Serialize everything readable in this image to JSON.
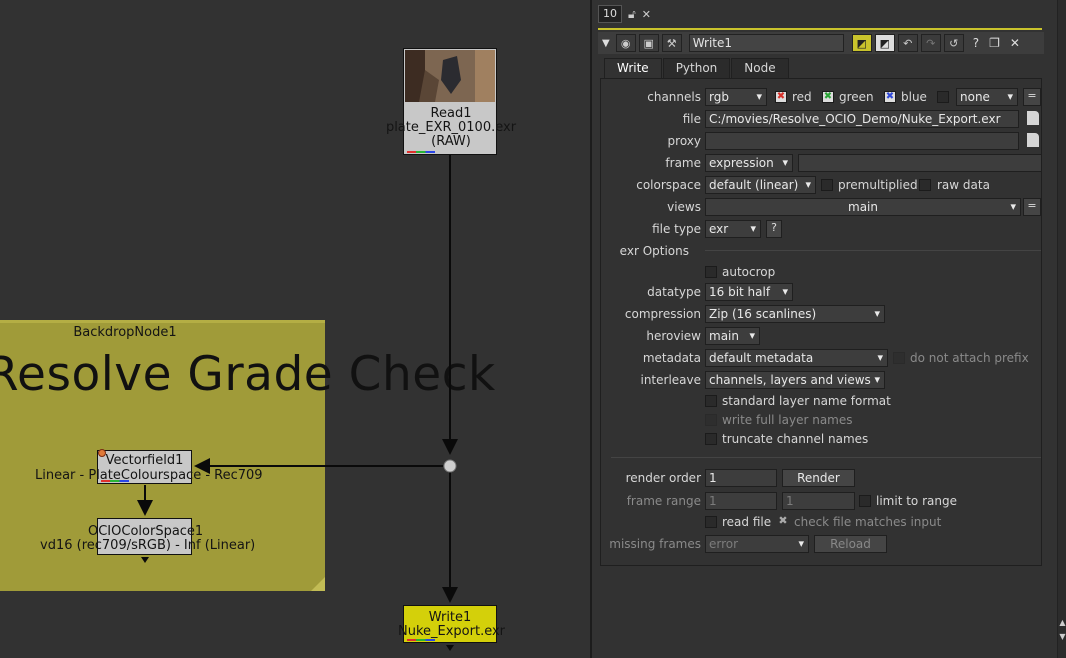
{
  "graph": {
    "backdrop": {
      "title": "BackdropNode1",
      "label": "Resolve Grade Check"
    },
    "read_node": {
      "name": "Read1",
      "file": "plate_EXR_0100.exr",
      "colorspace": "(RAW)"
    },
    "vectorfield_node": {
      "name": "Vectorfield1",
      "subtext": "Linear - PlateColourspace - Rec709"
    },
    "ocio_node": {
      "name": "OCIOColorSpace1",
      "subtext": "vd16 (rec709/sRGB) - Inf (Linear)"
    },
    "write_node": {
      "name": "Write1",
      "file": "Nuke_Export.exr"
    }
  },
  "panel": {
    "topbar": {
      "count": "10"
    },
    "node_name": "Write1",
    "tabs": [
      "Write",
      "Python",
      "Node"
    ],
    "channels": {
      "label": "channels",
      "value": "rgb",
      "red": "red",
      "green": "green",
      "blue": "blue",
      "extra": "none"
    },
    "file": {
      "label": "file",
      "value": "C:/movies/Resolve_OCIO_Demo/Nuke_Export.exr"
    },
    "proxy": {
      "label": "proxy",
      "value": ""
    },
    "frame": {
      "label": "frame",
      "mode": "expression",
      "value": ""
    },
    "colorspace": {
      "label": "colorspace",
      "value": "default (linear)",
      "premultiplied": "premultiplied",
      "raw_data": "raw data"
    },
    "views": {
      "label": "views",
      "value": "main"
    },
    "file_type": {
      "label": "file type",
      "value": "exr",
      "help": "?"
    },
    "exr_section": "exr Options",
    "autocrop": "autocrop",
    "datatype": {
      "label": "datatype",
      "value": "16 bit half"
    },
    "compression": {
      "label": "compression",
      "value": "Zip (16 scanlines)"
    },
    "heroview": {
      "label": "heroview",
      "value": "main"
    },
    "metadata": {
      "label": "metadata",
      "value": "default metadata",
      "prefix": "do not attach prefix"
    },
    "interleave": {
      "label": "interleave",
      "value": "channels, layers and views"
    },
    "standard_layer": "standard layer name format",
    "write_full_layer": "write full layer names",
    "truncate": "truncate channel names",
    "render_order": {
      "label": "render order",
      "value": "1",
      "render_button": "Render"
    },
    "frame_range": {
      "label": "frame range",
      "from": "1",
      "to": "1",
      "limit": "limit to range"
    },
    "read_file": {
      "label": "read file",
      "check": "check file matches input"
    },
    "missing_frames": {
      "label": "missing frames",
      "value": "error",
      "reload": "Reload"
    }
  },
  "colors": {
    "backdrop": "#a09b39",
    "write_node": "#d4d00a",
    "panel_bg": "#323232",
    "accent_line": "#c9c32c"
  }
}
